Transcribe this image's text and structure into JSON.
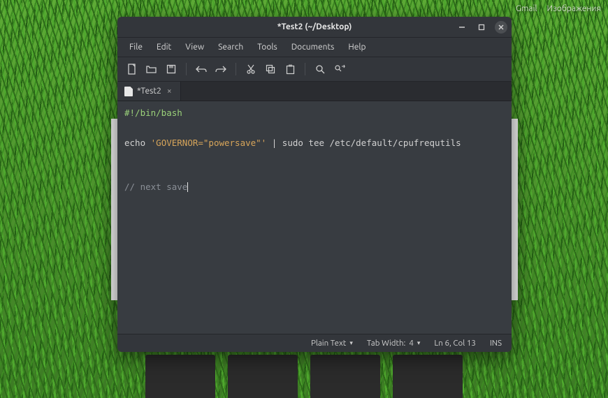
{
  "desktop": {
    "top_links": [
      "Gmail",
      "Изображения"
    ]
  },
  "window": {
    "title": "*Test2 (~/Desktop)",
    "menubar": [
      "File",
      "Edit",
      "View",
      "Search",
      "Tools",
      "Documents",
      "Help"
    ],
    "toolbar_icons": [
      "new-file-icon",
      "open-icon",
      "save-icon",
      "undo-icon",
      "redo-icon",
      "cut-icon",
      "copy-icon",
      "paste-icon",
      "find-icon",
      "find-replace-icon"
    ],
    "tab": {
      "label": "*Test2"
    },
    "editor": {
      "line1": "#!/bin/bash",
      "line2a": "echo ",
      "line2b": "'GOVERNOR=\"powersave\"'",
      "line2c": " | sudo tee /etc/default/cpufrequtils",
      "line3": "// next save"
    },
    "status": {
      "language": "Plain Text",
      "tab_width_label": "Tab Width:",
      "tab_width_value": "4",
      "position": "Ln 6, Col 13",
      "insert_mode": "INS"
    }
  }
}
